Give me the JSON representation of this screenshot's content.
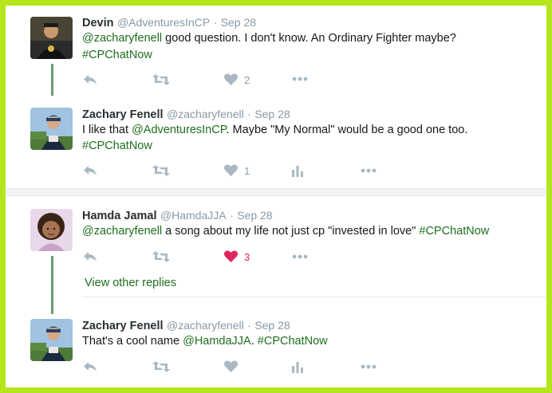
{
  "tweets": [
    {
      "name": "Devin",
      "handle": "@AdventuresInCP",
      "sep": "·",
      "date": "Sep 28",
      "segments": [
        {
          "text": "@zacharyfenell",
          "link": true
        },
        {
          "text": " good question. I don't know. An Ordinary Fighter maybe?",
          "link": false
        }
      ],
      "line2": [
        {
          "text": "#CPChatNow",
          "link": true
        }
      ],
      "likes": "2"
    },
    {
      "name": "Zachary Fenell",
      "handle": "@zacharyfenell",
      "sep": "·",
      "date": "Sep 28",
      "segments": [
        {
          "text": "I like that ",
          "link": false
        },
        {
          "text": "@AdventuresInCP",
          "link": true
        },
        {
          "text": ". Maybe \"My Normal\" would be a good one too.",
          "link": false
        }
      ],
      "line2": [
        {
          "text": "#CPChatNow",
          "link": true
        }
      ],
      "likes": "1"
    },
    {
      "name": "Hamda Jamal",
      "handle": "@HamdaJJA",
      "sep": "·",
      "date": "Sep 28",
      "segments": [
        {
          "text": "@zacharyfenell",
          "link": true
        },
        {
          "text": " a song about my life not just cp \"invested in love\" ",
          "link": false
        },
        {
          "text": "#CPChatNow",
          "link": true
        }
      ],
      "likes": "3"
    },
    {
      "name": "Zachary Fenell",
      "handle": "@zacharyfenell",
      "sep": "·",
      "date": "Sep 28",
      "segments": [
        {
          "text": "That's a cool name ",
          "link": false
        },
        {
          "text": "@HamdaJJA",
          "link": true
        },
        {
          "text": ". ",
          "link": false
        },
        {
          "text": "#CPChatNow",
          "link": true
        }
      ]
    }
  ],
  "view_other_replies": "View other replies",
  "colors": {
    "border": "#b5e61d",
    "link": "#1e6e1e",
    "liked": "#e0245e",
    "icon": "#aab8c2",
    "thread": "#6b9e6b"
  },
  "icons": [
    "reply-icon",
    "retweet-icon",
    "heart-icon",
    "more-icon",
    "analytics-icon"
  ]
}
